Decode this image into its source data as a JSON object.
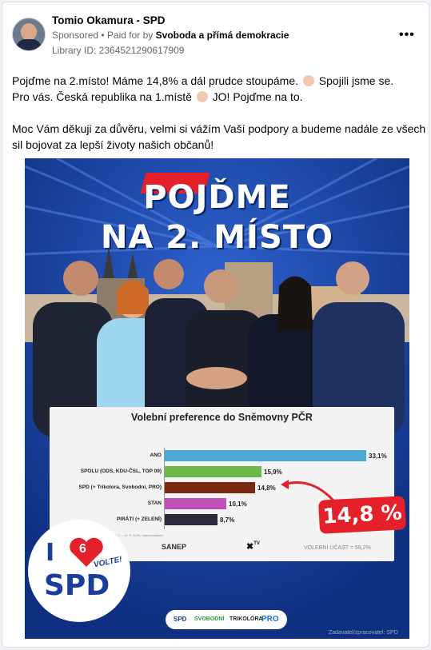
{
  "post": {
    "page_name": "Tomio Okamura - SPD",
    "sponsored": "Sponsored",
    "paid_for_prefix": "• Paid for by",
    "paid_for_by": "Svoboda a přímá demokracie",
    "library_id": "Library ID: 2364521290617909",
    "more_label": "•••",
    "text_line1a": "Pojďme na 2.místo! Máme 14,8% a dál prudce stoupáme.",
    "text_line1b": "Spojili jsme se.",
    "text_line2a": "Pro vás. Česká republika na 1.místě",
    "text_line2b": "JO! Pojďme na to.",
    "text_line3": "Moc Vám děkuji za důvěru, velmi si vážím Vaší podpory a budeme nadále ze všech",
    "text_line4": "sil bojovat za lepší životy našich občanů!"
  },
  "poster": {
    "headline1": "POJĎME",
    "headline2": "NA 2. MÍSTO",
    "badge": "14,8 %",
    "logo_i": "I",
    "logo_number": "6",
    "logo_volte": "VOLTE!",
    "logo_spd": "SPD",
    "partner_spd": "SPD",
    "partner_svobodni": "SVOBODNÍ",
    "partner_trikolora": "TRIKOLÓRA",
    "partner_pro": "PRO",
    "credit": "Zadavatel/zpracovatel: SPD"
  },
  "chart_data": {
    "type": "bar",
    "title": "Volební preference do Sněmovny PČR",
    "categories": [
      "ANO",
      "SPOLU (ODS, KDU-ČSL, TOP 09)",
      "SPD (+ Trikolora, Svobodní, PRO)",
      "STAN",
      "PIRÁTI (+ ZELENÍ)"
    ],
    "values": [
      33.1,
      15.9,
      14.8,
      10.1,
      8.7
    ],
    "value_labels": [
      "33,1%",
      "15,9%",
      "14,8%",
      "10,1%",
      "8,7%"
    ],
    "colors": [
      "#4aa9d4",
      "#6db84a",
      "#7a2a10",
      "#c04fb8",
      "#2a2a3a"
    ],
    "source_label": "SANEP",
    "media_label": "TV",
    "turnout": "VOLEBNÍ ÚČAST = 59,2%"
  }
}
